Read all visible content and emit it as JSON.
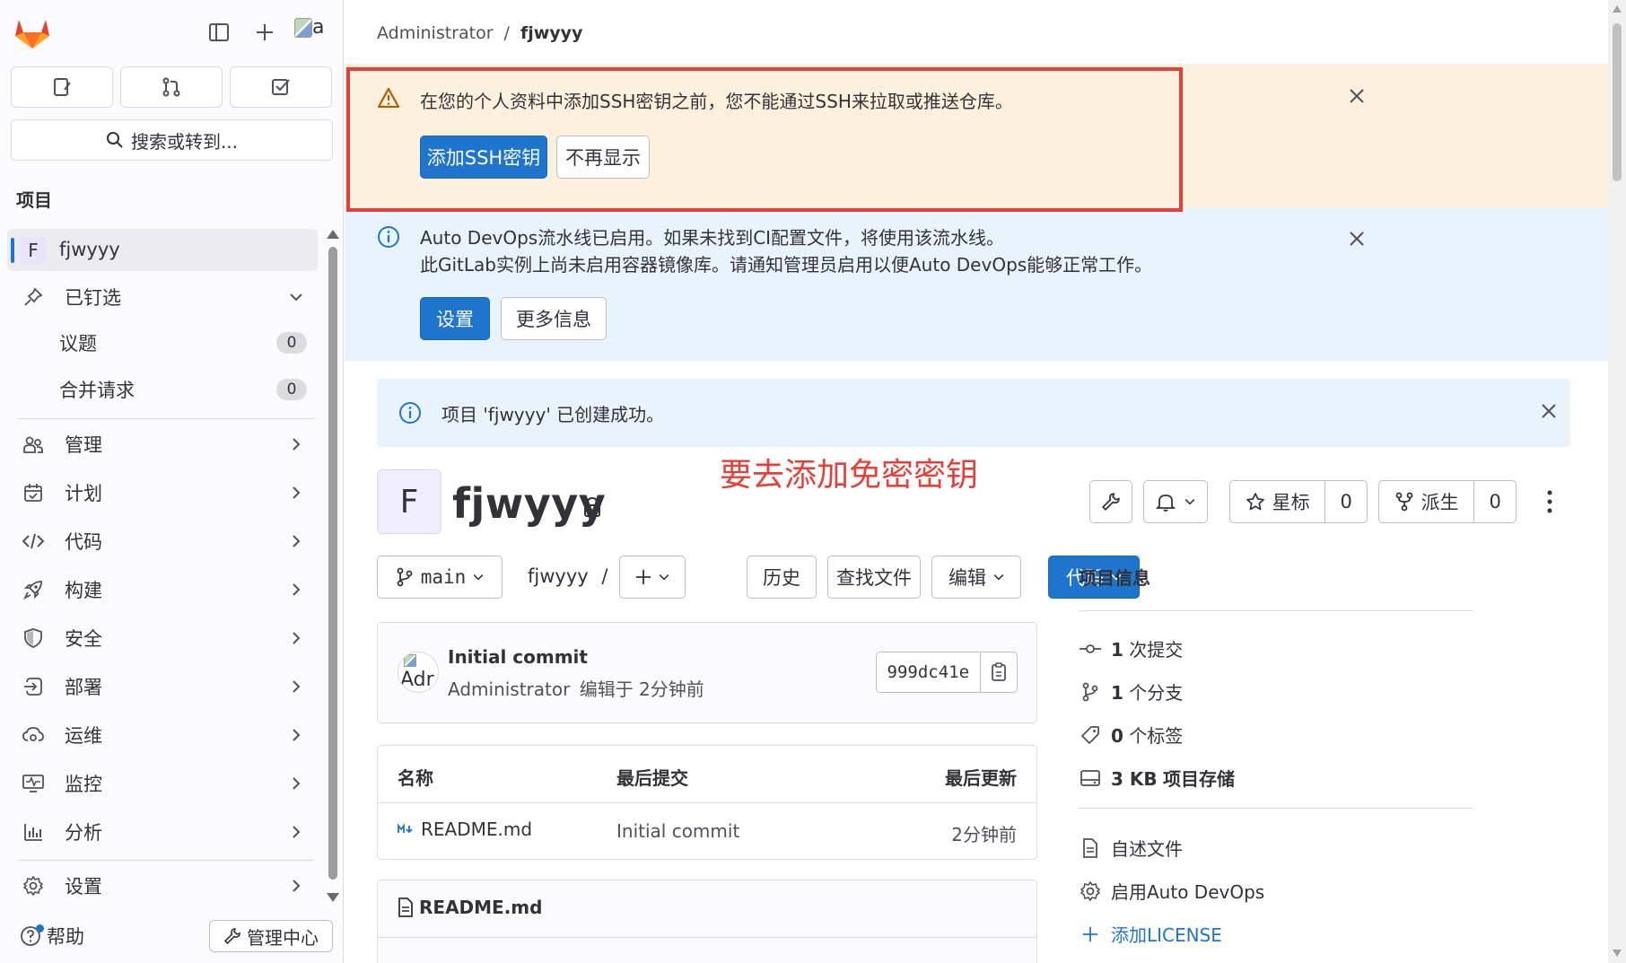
{
  "sidebar": {
    "quick_actions": [
      "issues",
      "merge-requests",
      "todos"
    ],
    "search_label": "搜索或转到...",
    "section_heading": "项目",
    "project": {
      "letter": "F",
      "name": "fjwyyy"
    },
    "pinned": {
      "label": "已钉选",
      "items": [
        {
          "label": "议题",
          "count": "0"
        },
        {
          "label": "合并请求",
          "count": "0"
        }
      ]
    },
    "nav": [
      {
        "label": "管理",
        "icon": "users-icon"
      },
      {
        "label": "计划",
        "icon": "calendar-icon"
      },
      {
        "label": "代码",
        "icon": "code-icon"
      },
      {
        "label": "构建",
        "icon": "rocket-icon"
      },
      {
        "label": "安全",
        "icon": "shield-icon"
      },
      {
        "label": "部署",
        "icon": "deploy-icon"
      },
      {
        "label": "运维",
        "icon": "cloud-gear-icon"
      },
      {
        "label": "监控",
        "icon": "monitor-icon"
      },
      {
        "label": "分析",
        "icon": "chart-icon"
      }
    ],
    "settings": "设置",
    "help": "帮助",
    "admin": "管理中心",
    "avatar_alt": "a"
  },
  "breadcrumb": {
    "parent": "Administrator",
    "separator": "/",
    "current": "fjwyyy"
  },
  "ssh_banner": {
    "message": "在您的个人资料中添加SSH密钥之前，您不能通过SSH来拉取或推送仓库。",
    "primary": "添加SSH密钥",
    "secondary": "不再显示"
  },
  "devops_banner": {
    "line1": "Auto DevOps流水线已启用。如果未找到CI配置文件，将使用该流水线。",
    "line2": "此GitLab实例上尚未启用容器镜像库。请通知管理员启用以便Auto DevOps能够正常工作。",
    "primary": "设置",
    "secondary": "更多信息"
  },
  "created_alert": "项目 'fjwyyy' 已创建成功。",
  "annotation": "要去添加免密密钥",
  "project": {
    "letter": "F",
    "name": "fjwyyy",
    "star_label": "星标",
    "star_count": "0",
    "fork_label": "派生",
    "fork_count": "0"
  },
  "toolbar": {
    "branch": "main",
    "path": "fjwyyy",
    "path_sep": "/",
    "history": "历史",
    "find_file": "查找文件",
    "edit": "编辑",
    "code": "代码"
  },
  "commit": {
    "avatar_text": "Adr",
    "title": "Initial commit",
    "author": "Administrator",
    "meta": "编辑于 2分钟前",
    "sha": "999dc41e"
  },
  "files": {
    "headers": [
      "名称",
      "最后提交",
      "最后更新"
    ],
    "rows": [
      {
        "name": "README.md",
        "commit": "Initial commit",
        "updated": "2分钟前"
      }
    ]
  },
  "readme": {
    "title": "README.md"
  },
  "project_info": {
    "title": "项目信息",
    "stats": [
      {
        "value": "1",
        "label": "次提交",
        "icon": "commit-icon"
      },
      {
        "value": "1",
        "label": "个分支",
        "icon": "branch-icon"
      },
      {
        "value": "0",
        "label": "个标签",
        "icon": "tag-icon"
      },
      {
        "value": "3 KB",
        "label": "项目存储",
        "icon": "storage-icon"
      }
    ],
    "links": [
      {
        "label": "自述文件",
        "icon": "doc-icon"
      },
      {
        "label": "启用Auto DevOps",
        "icon": "gear-icon"
      },
      {
        "label": "添加LICENSE",
        "icon": "plus-icon"
      }
    ]
  },
  "colors": {
    "primary": "#1f75cb",
    "warning_bg": "#fdf1dd",
    "info_bg": "#e9f3fc",
    "annotation": "#e5403a"
  }
}
